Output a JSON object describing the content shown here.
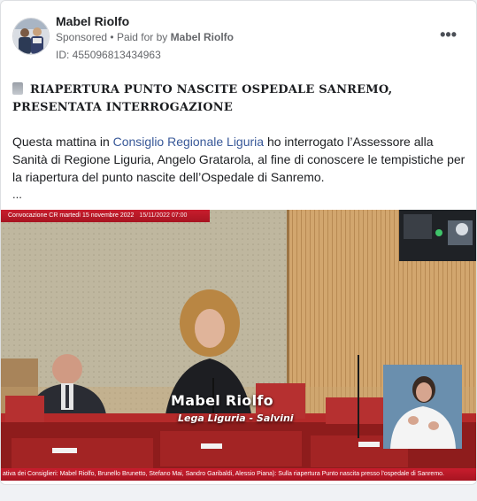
{
  "post": {
    "author": "Mabel Riolfo",
    "sponsored_label": "Sponsored",
    "separator": "•",
    "paid_for_prefix": "Paid for by",
    "paid_for_name": "Mabel Riolfo",
    "ad_id": "ID: 455096813434963",
    "more_icon": "more-horizontal-icon",
    "more_label": "•••"
  },
  "content": {
    "headline_icon": "document-icon",
    "headline": "RIAPERTURA PUNTO NASCITE OSPEDALE SANREMO, PRESENTATA INTERROGAZIONE",
    "body_pre": "Questa mattina in ",
    "body_link": "Consiglio Regionale Liguria",
    "body_post": " ho interrogato l’Assessore alla Sanità di Regione Liguria, Angelo Gratarola, al fine di conoscere le tempistiche per la riapertura del punto nascite dell’Ospedale di Sanremo.",
    "ellipsis": "..."
  },
  "video": {
    "ticker_top": "Convocazione CR martedì 15 novembre 2022",
    "ticker_top_date": "15/11/2022 07:00",
    "lower_third_name": "Mabel Riolfo",
    "lower_third_sub": "Lega Liguria - Salvini",
    "ticker_bottom": "ativa dei Consiglieri: Mabel Riolfo, Brunello Brunetto, Stefano Mai, Sandro Garibaldi, Alessio Piana): Sulla riapertura Punto nascita presso l'ospedale di Sanremo.",
    "colors": {
      "ticker_red": "#c81d2d",
      "wood": "#cfa26b",
      "wall": "#bdb49b"
    }
  }
}
